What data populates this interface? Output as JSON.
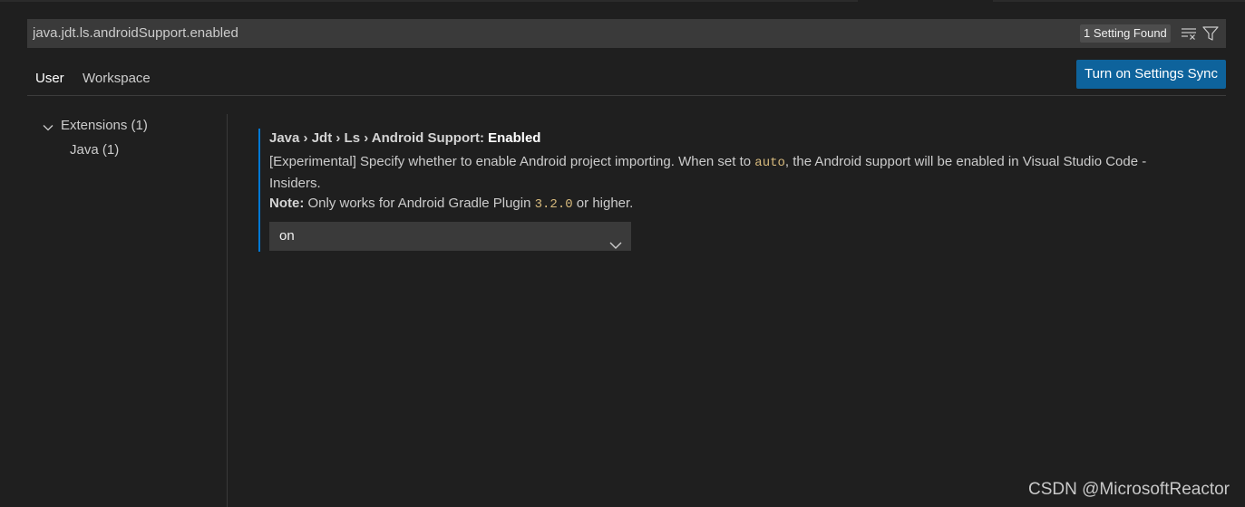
{
  "search": {
    "value": "java.jdt.ls.androidSupport.enabled",
    "results_badge": "1 Setting Found"
  },
  "tabs": [
    {
      "label": "User",
      "active": true
    },
    {
      "label": "Workspace",
      "active": false
    }
  ],
  "sync_button": "Turn on Settings Sync",
  "tree": {
    "group": {
      "label": "Extensions (1)",
      "expanded": true
    },
    "children": [
      {
        "label": "Java (1)"
      }
    ]
  },
  "setting": {
    "breadcrumb": "Java › Jdt › Ls › Android Support: ",
    "name": "Enabled",
    "description_part1": "[Experimental] Specify whether to enable Android project importing. When set to ",
    "description_code": "auto",
    "description_part2": ", the Android support will be enabled in Visual Studio Code - Insiders.",
    "note_label": "Note:",
    "note_part1": " Only works for Android Gradle Plugin ",
    "note_code": "3.2.0",
    "note_part2": " or higher.",
    "selected_value": "on"
  },
  "watermark": "CSDN @MicrosoftReactor",
  "colors": {
    "background": "#1f1f1f",
    "input_background": "#3a3a3a",
    "accent_button": "#0e639c",
    "focus_border": "#0078d4",
    "code_text": "#d7ba7d"
  },
  "icons": {
    "clear_filter": "clear-all-icon",
    "filter": "filter-icon",
    "tree_expand": "chevron-down-icon",
    "select_open": "chevron-down-icon"
  }
}
